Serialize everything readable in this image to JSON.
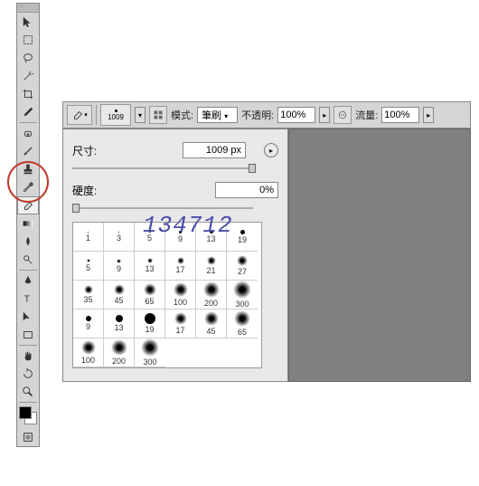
{
  "toolbar": {
    "tools": [
      "move",
      "marquee",
      "lasso",
      "wand",
      "crop",
      "eyedropper",
      "heal",
      "brush",
      "stamp",
      "history",
      "eraser",
      "gradient",
      "blur",
      "dodge",
      "pen",
      "type",
      "path",
      "rect",
      "hand",
      "zoom",
      "rotate",
      "fg-bg",
      "mask"
    ]
  },
  "options": {
    "brush_size": "1009",
    "mode_label": "模式:",
    "mode_value": "筆刷",
    "opacity_label": "不透明:",
    "opacity_value": "100%",
    "flow_label": "流量:",
    "flow_value": "100%"
  },
  "brush_panel": {
    "size_label": "尺寸:",
    "size_value": "1009 px",
    "hardness_label": "硬度:",
    "hardness_value": "0%",
    "presets": [
      [
        {
          "t": "hard",
          "s": 1,
          "l": "1"
        },
        {
          "t": "hard",
          "s": 1,
          "l": "3"
        },
        {
          "t": "hard",
          "s": 2,
          "l": "5"
        },
        {
          "t": "hard",
          "s": 3,
          "l": "9"
        },
        {
          "t": "hard",
          "s": 4,
          "l": "13"
        },
        {
          "t": "hard",
          "s": 5,
          "l": "19"
        }
      ],
      [
        {
          "t": "soft",
          "s": 4,
          "l": "5"
        },
        {
          "t": "soft",
          "s": 5,
          "l": "9"
        },
        {
          "t": "soft",
          "s": 6,
          "l": "13"
        },
        {
          "t": "soft",
          "s": 8,
          "l": "17"
        },
        {
          "t": "soft",
          "s": 10,
          "l": "21"
        },
        {
          "t": "soft",
          "s": 12,
          "l": "27"
        }
      ],
      [
        {
          "t": "soft",
          "s": 10,
          "l": "35"
        },
        {
          "t": "soft",
          "s": 12,
          "l": "45"
        },
        {
          "t": "soft",
          "s": 14,
          "l": "65"
        },
        {
          "t": "soft",
          "s": 16,
          "l": "100"
        },
        {
          "t": "soft",
          "s": 18,
          "l": "200"
        },
        {
          "t": "soft",
          "s": 20,
          "l": "300"
        }
      ],
      [
        {
          "t": "hard",
          "s": 6,
          "l": "9"
        },
        {
          "t": "hard",
          "s": 8,
          "l": "13"
        },
        {
          "t": "hard",
          "s": 12,
          "l": "19"
        },
        {
          "t": "soft",
          "s": 14,
          "l": "17"
        },
        {
          "t": "soft",
          "s": 16,
          "l": "45"
        },
        {
          "t": "soft",
          "s": 18,
          "l": "65"
        }
      ],
      [
        {
          "t": "soft",
          "s": 16,
          "l": "100"
        },
        {
          "t": "soft",
          "s": 18,
          "l": "200"
        },
        {
          "t": "soft",
          "s": 20,
          "l": "300"
        }
      ]
    ]
  },
  "watermark": "134712"
}
